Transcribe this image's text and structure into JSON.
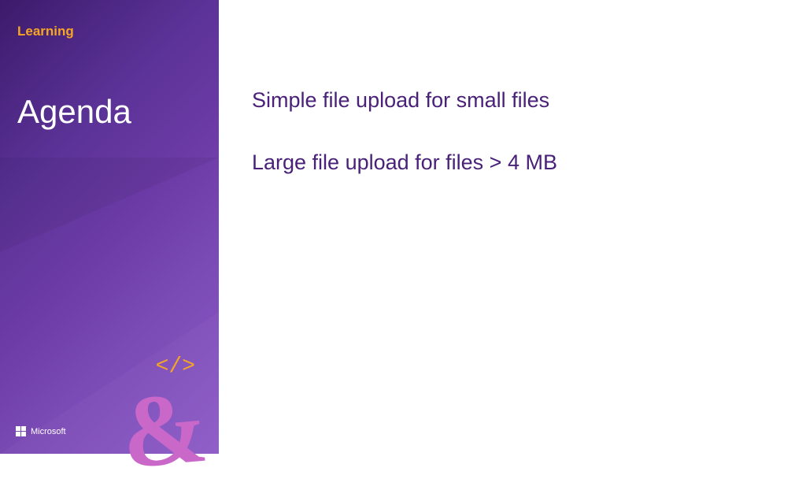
{
  "sidebar": {
    "learning_label": "Learning",
    "title": "Agenda",
    "code_tag": "</>",
    "ampersand": "&",
    "ms_brand": "Microsoft"
  },
  "main": {
    "bullets": [
      "Simple file upload for small files",
      "Large file upload for files > 4 MB"
    ]
  }
}
